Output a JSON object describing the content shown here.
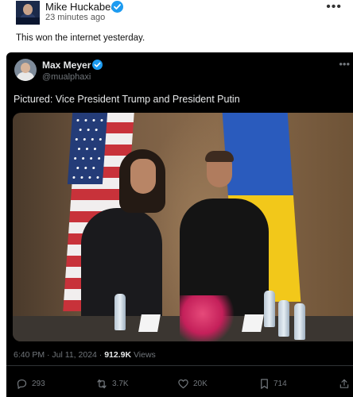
{
  "outer_post": {
    "author_name": "Mike Huckabee",
    "timestamp": "23 minutes ago",
    "text": "This won the internet yesterday.",
    "more_icon": "more-horizontal-icon"
  },
  "quoted_tweet": {
    "author_name": "Max Meyer",
    "handle": "@mualphaxi",
    "text": "Pictured: Vice President Trump and President Putin",
    "time": "6:40 PM · Jul 11, 2024 · ",
    "views_count": "912.9K",
    "views_label": " Views",
    "actions": {
      "replies": "293",
      "reposts": "3.7K",
      "likes": "20K",
      "bookmarks": "714"
    }
  },
  "colors": {
    "verified": "#1d9bf0",
    "tweet_bg": "#000000",
    "muted": "#71767b",
    "text_light": "#e7e9ea"
  }
}
